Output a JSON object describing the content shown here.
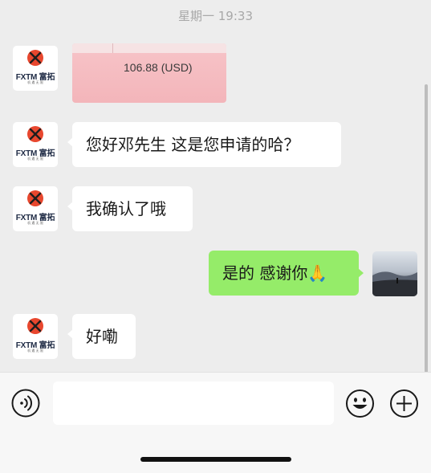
{
  "timestamp": "星期一 19:33",
  "contact": {
    "logo_text": "FXTM 富拓",
    "logo_sub": "机 遇 无 限"
  },
  "messages": [
    {
      "type": "image",
      "from": "contact",
      "amount_text": "106.88 (USD)"
    },
    {
      "type": "text",
      "from": "contact",
      "text": "您好邓先生 这是您申请的哈？"
    },
    {
      "type": "text",
      "from": "contact",
      "text": "我确认了哦"
    },
    {
      "type": "text",
      "from": "me",
      "text": "是的 感谢你🙏"
    },
    {
      "type": "text",
      "from": "contact",
      "text": "好嘞"
    }
  ],
  "input": {
    "value": "",
    "placeholder": ""
  },
  "icons": {
    "voice": "voice-icon",
    "emoji": "emoji-icon",
    "more": "plus-icon"
  },
  "colors": {
    "background": "#ededed",
    "my_bubble": "#95ec69",
    "contact_bubble": "#ffffff",
    "logo_accent": "#e8472e"
  }
}
